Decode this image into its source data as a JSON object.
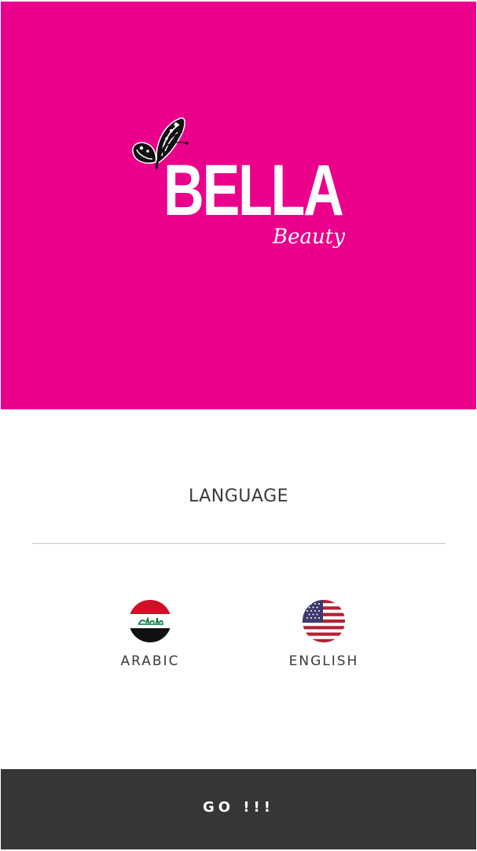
{
  "colors": {
    "brand_pink": "#ea008b",
    "bottom_bar": "#363639",
    "text_dark": "#3a3a3a",
    "divider": "#c8c8c8"
  },
  "logo": {
    "icon": "butterfly-icon",
    "name": "BELLA",
    "subtitle": "Beauty"
  },
  "language_section": {
    "title": "LANGUAGE",
    "options": [
      {
        "label": "ARABIC",
        "icon": "iraq-flag-icon"
      },
      {
        "label": "ENGLISH",
        "icon": "usa-flag-icon"
      }
    ]
  },
  "go_button": {
    "label": "GO !!!"
  }
}
